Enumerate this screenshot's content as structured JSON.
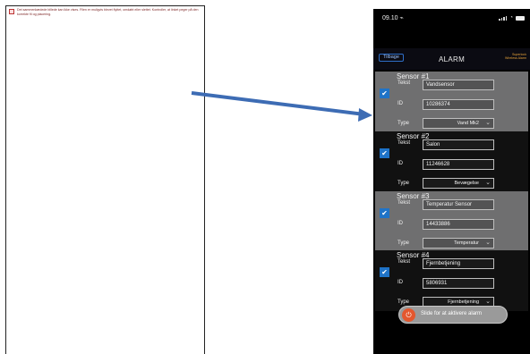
{
  "document": {
    "broken_image_icon": "broken-image-icon",
    "message": "Det sammenkædede billede kan ikke vises. Filen er muligvis blevet flyttet, omdøbt eller slettet. Kontroller, at linket peger på den korrekte fil og placering."
  },
  "arrow": {
    "color": "#3d6cb4"
  },
  "phone": {
    "status": {
      "time": "09.10 ⌁",
      "wifi_icon": "wifi-icon",
      "battery_icon": "battery-icon"
    },
    "nav": {
      "back_label": "Tilbage",
      "title": "ALARM",
      "logo_text": "Superlock Wireless Alarm"
    },
    "sensors": [
      {
        "header": "Sensor #1",
        "checked": true,
        "tekst_label": "Tekst",
        "tekst_value": "Vandsensor",
        "id_label": "ID",
        "id_value": "10286374",
        "type_label": "Type",
        "type_value": "Vand Mk2"
      },
      {
        "header": "Sensor #2",
        "checked": true,
        "tekst_label": "Tekst",
        "tekst_value": "Salon",
        "id_label": "ID",
        "id_value": "11246628",
        "type_label": "Type",
        "type_value": "Bevægelse"
      },
      {
        "header": "Sensor #3",
        "checked": true,
        "tekst_label": "Tekst",
        "tekst_value": "Temperatur Sensor",
        "id_label": "ID",
        "id_value": "14433886",
        "type_label": "Type",
        "type_value": "Temperatur"
      },
      {
        "header": "Sensor #4",
        "checked": true,
        "tekst_label": "Tekst",
        "tekst_value": "Fjernbetjening",
        "id_label": "ID",
        "id_value": "5806931",
        "type_label": "Type",
        "type_value": "Fjernbetjening"
      }
    ],
    "slider": {
      "label": "Slide for at aktivere alarm",
      "icon": "power-icon"
    }
  },
  "colors": {
    "accent": "#1f73c7",
    "row_highlight": "#6f6f70",
    "slider_knob": "#e4572e",
    "logo": "#e7a33a"
  }
}
